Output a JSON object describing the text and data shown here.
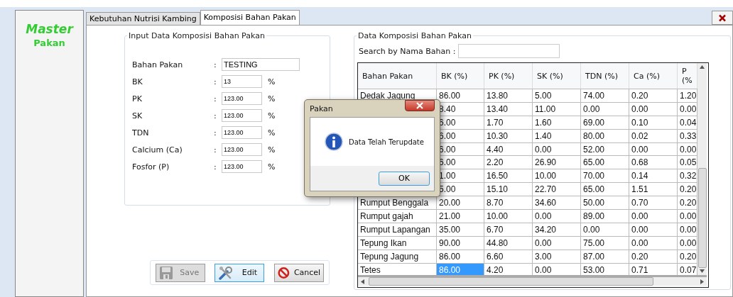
{
  "sidebar": {
    "title": "Master",
    "subtitle": "Pakan"
  },
  "tabs": [
    {
      "label": "Kebutuhan Nutrisi Kambing",
      "selected": false
    },
    {
      "label": "Komposisi Bahan Pakan",
      "selected": true
    }
  ],
  "input_group": {
    "title": "Input Data Komposisi Bahan Pakan",
    "fields": [
      {
        "kind": "text",
        "label": "Bahan Pakan",
        "value": "TESTING"
      },
      {
        "kind": "percent",
        "label": "BK",
        "value": "13",
        "unit": "%"
      },
      {
        "kind": "percent",
        "label": "PK",
        "value": "123.00",
        "unit": "%"
      },
      {
        "kind": "percent",
        "label": "SK",
        "value": "123.00",
        "unit": "%"
      },
      {
        "kind": "percent",
        "label": "TDN",
        "value": "123.00",
        "unit": "%"
      },
      {
        "kind": "percent",
        "label": "Calcium (Ca)",
        "value": "123.00",
        "unit": "%"
      },
      {
        "kind": "percent",
        "label": "Fosfor (P)",
        "value": "123.00",
        "unit": "%"
      }
    ],
    "separator": ":"
  },
  "buttons": [
    {
      "kind": "save",
      "label": "Save",
      "disabled": true,
      "focused": false
    },
    {
      "kind": "edit",
      "label": "Edit",
      "disabled": false,
      "focused": true
    },
    {
      "kind": "cancel",
      "label": "Cancel",
      "disabled": false,
      "focused": false
    }
  ],
  "table_group": {
    "title": "Data Komposisi Bahan Pakan",
    "search": {
      "label": "Search by Nama Bahan :"
    },
    "table": {
      "columns": [
        "Bahan Pakan",
        "BK (%)",
        "PK (%)",
        "SK (%)",
        "TDN (%)",
        "Ca (%)",
        "P (%"
      ],
      "rows": [
        {
          "cells": [
            "Dedak Jagung",
            "86.00",
            "13.80",
            "5.00",
            "74.00",
            "0.20",
            "1.20"
          ],
          "selected": false
        },
        {
          "cells": [
            "",
            "8.40",
            "13.40",
            "11.00",
            "0.00",
            "0.00",
            "0.00"
          ],
          "selected": false
        },
        {
          "cells": [
            "",
            "6.00",
            "1.70",
            "1.60",
            "69.00",
            "0.10",
            "0.04"
          ],
          "selected": false
        },
        {
          "cells": [
            "",
            "6.00",
            "10.30",
            "1.40",
            "80.00",
            "0.02",
            "0.33"
          ],
          "selected": false
        },
        {
          "cells": [
            "",
            "6.00",
            "4.40",
            "0.00",
            "52.00",
            "0.00",
            "0.00"
          ],
          "selected": false
        },
        {
          "cells": [
            "",
            "6.00",
            "2.20",
            "26.90",
            "65.00",
            "0.68",
            "0.05"
          ],
          "selected": false
        },
        {
          "cells": [
            "",
            "1.00",
            "16.50",
            "10.00",
            "70.00",
            "0.14",
            "0.32"
          ],
          "selected": false
        },
        {
          "cells": [
            "",
            "5.00",
            "15.10",
            "22.70",
            "65.00",
            "1.51",
            "0.20"
          ],
          "selected": false
        },
        {
          "cells": [
            "Rumput Benggala",
            "20.00",
            "8.70",
            "34.60",
            "50.00",
            "0.70",
            "0.20"
          ],
          "selected": false
        },
        {
          "cells": [
            "Rumput gajah",
            "21.00",
            "10.00",
            "0.00",
            "89.00",
            "0.00",
            "0.00"
          ],
          "selected": false
        },
        {
          "cells": [
            "Rumput Lapangan",
            "35.00",
            "6.70",
            "34.20",
            "0.00",
            "0.00",
            "0.00"
          ],
          "selected": false
        },
        {
          "cells": [
            "Tepung Ikan",
            "90.00",
            "44.80",
            "0.00",
            "75.00",
            "0.00",
            "0.00"
          ],
          "selected": false
        },
        {
          "cells": [
            "Tepung Jagung",
            "86.00",
            "6.60",
            "3.00",
            "87.00",
            "0.20",
            "0.20"
          ],
          "selected": false
        },
        {
          "cells": [
            "Tetes",
            "86.00",
            "4.20",
            "0.00",
            "53.00",
            "0.71",
            "0.07"
          ],
          "selected": true
        }
      ]
    }
  },
  "dialog": {
    "title": "Pakan",
    "message": "Data Telah Terupdate",
    "button": "OK"
  }
}
